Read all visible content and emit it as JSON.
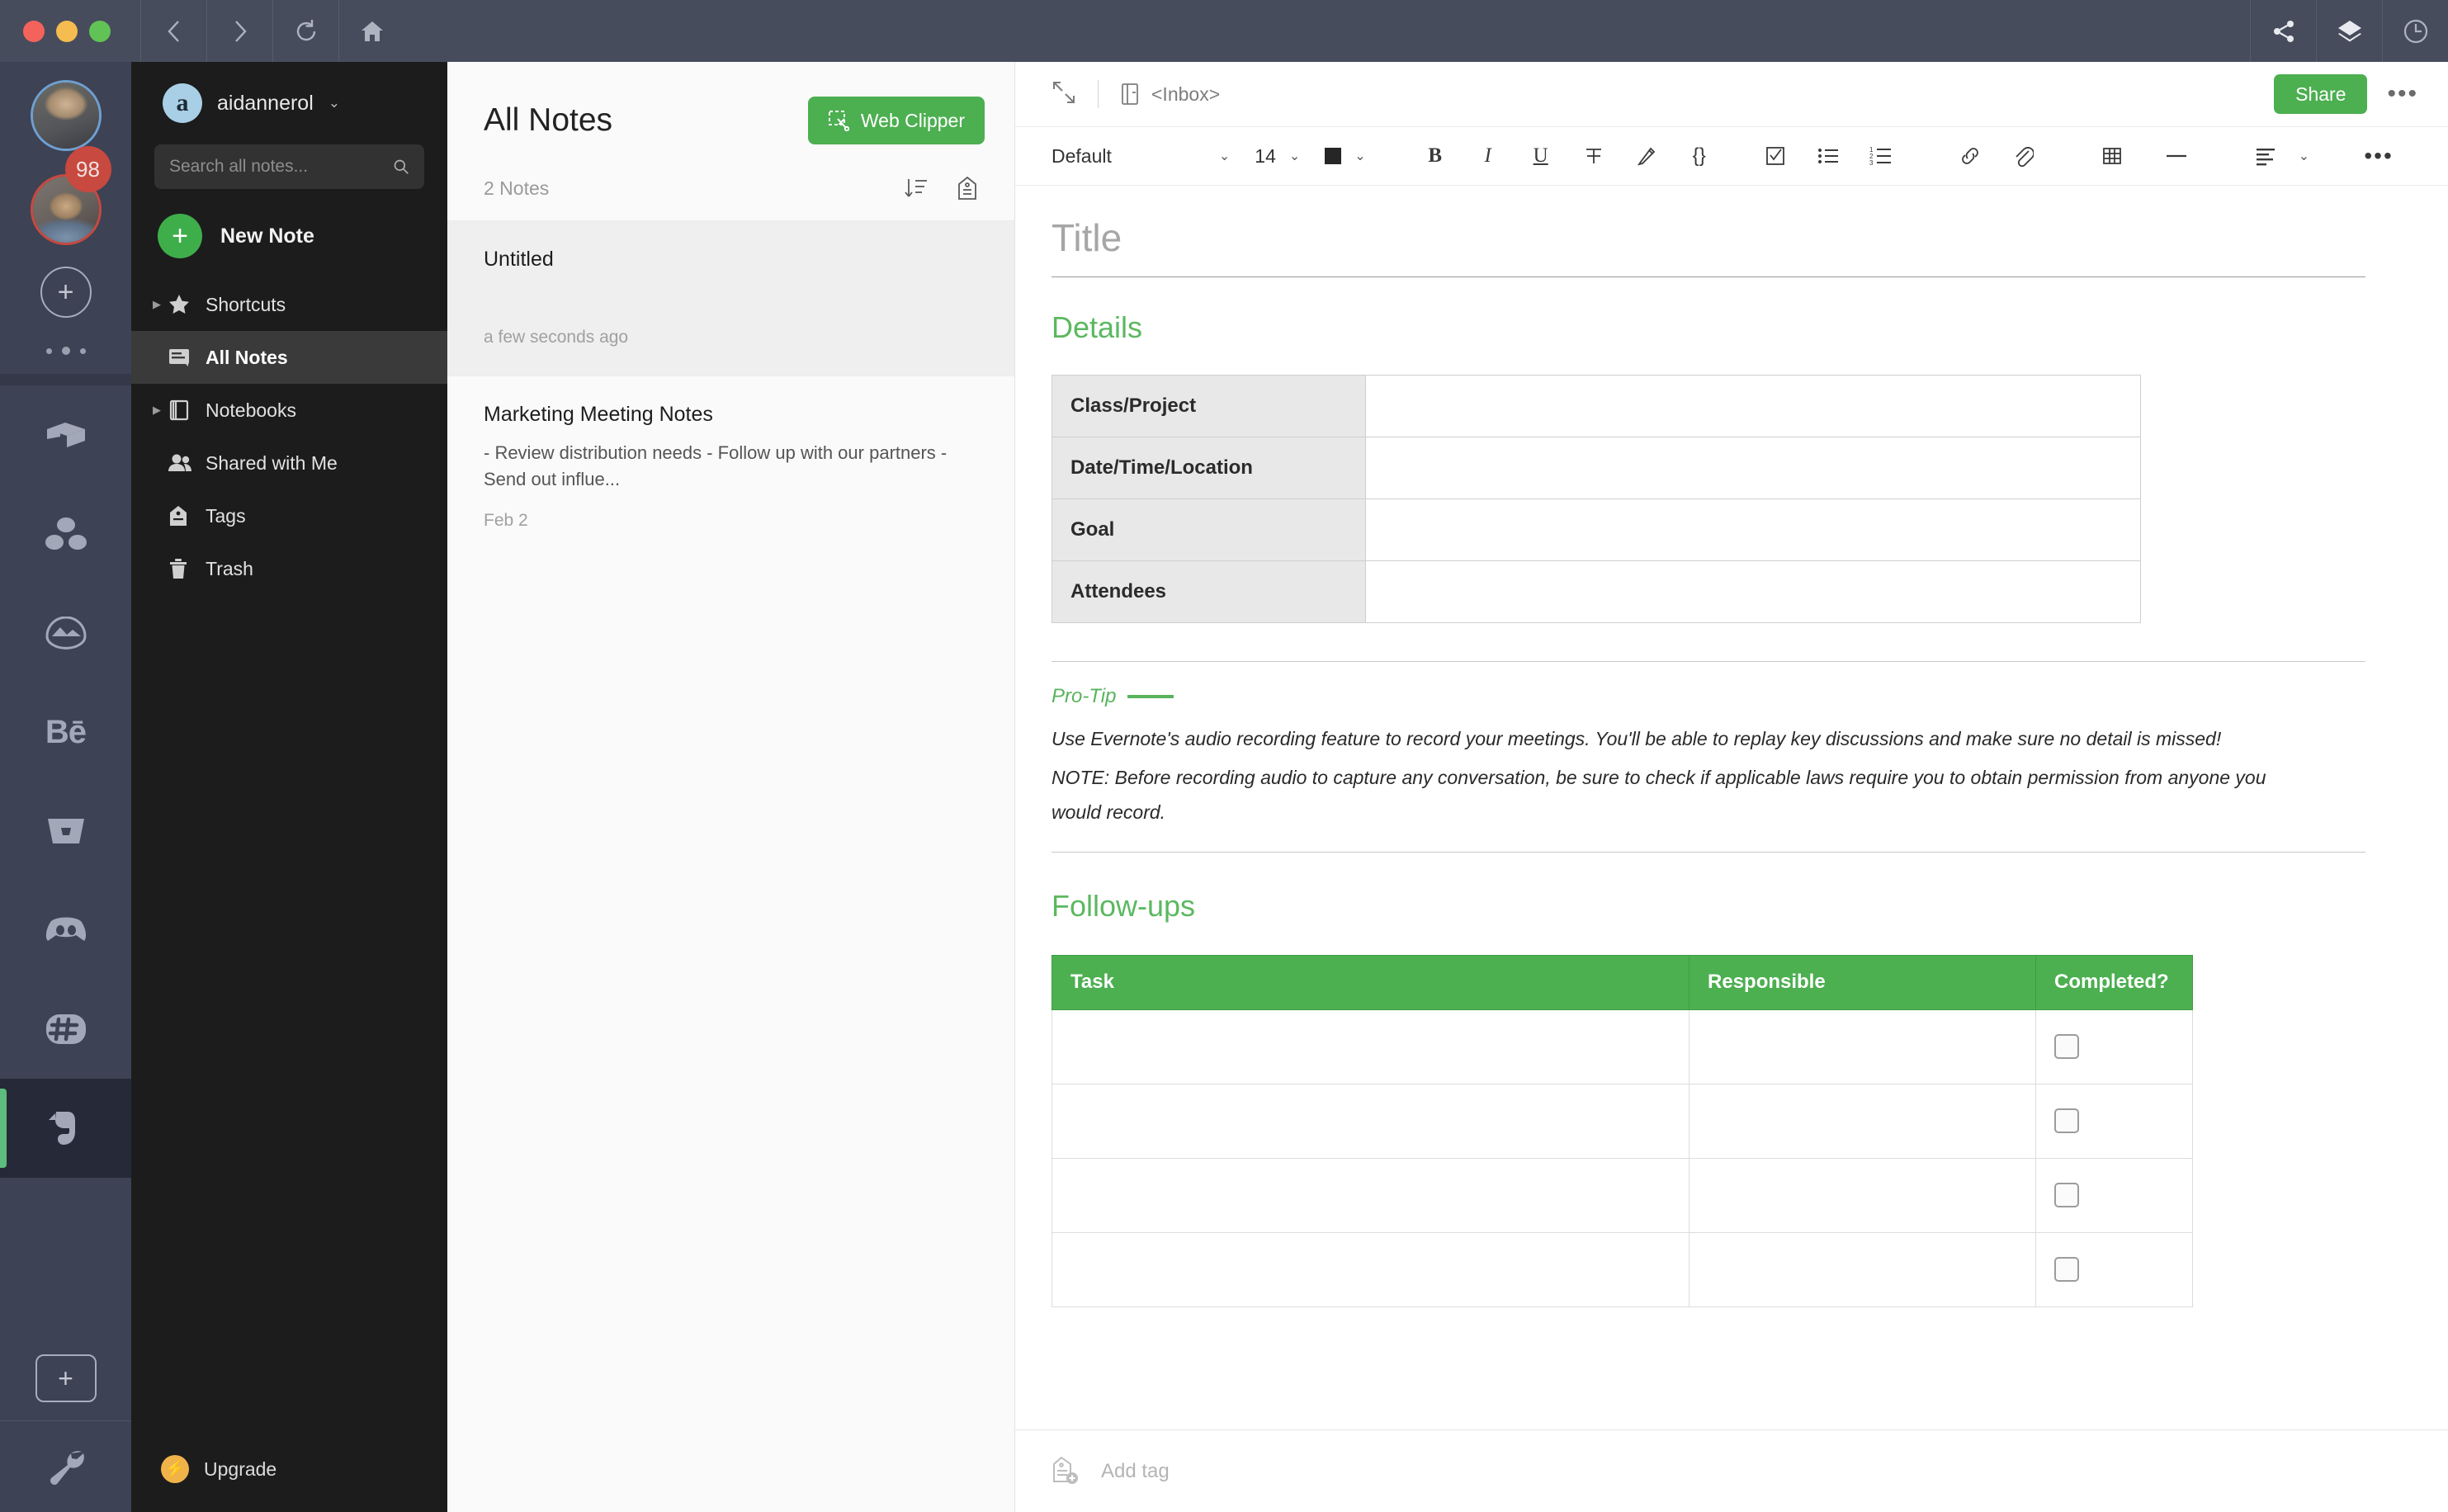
{
  "titlebar": {
    "traffic_lights": [
      "close",
      "minimize",
      "maximize"
    ],
    "nav": [
      {
        "name": "back",
        "icon": "chevron-left-icon"
      },
      {
        "name": "forward",
        "icon": "chevron-right-icon"
      },
      {
        "name": "reload",
        "icon": "reload-icon"
      },
      {
        "name": "home",
        "icon": "home-icon"
      }
    ],
    "right_actions": [
      {
        "name": "share",
        "icon": "share-icon"
      },
      {
        "name": "stack",
        "icon": "layers-icon"
      },
      {
        "name": "history",
        "icon": "clock-icon"
      }
    ],
    "accent": "#474c5c"
  },
  "rail": {
    "avatars": [
      {
        "name": "profile-avatar-1",
        "ring": "#6f9fd0",
        "badge": ""
      },
      {
        "name": "profile-avatar-2",
        "ring": "#c8493f",
        "badge": "98"
      }
    ],
    "add_profile_label": "+",
    "apps": [
      {
        "name": "dropbox",
        "icon": "box-icon"
      },
      {
        "name": "asana",
        "icon": "three-dots-circle-icon"
      },
      {
        "name": "icloud",
        "icon": "cloud-icon"
      },
      {
        "name": "behance",
        "icon": "behance-icon",
        "label": "Bē"
      },
      {
        "name": "basecamp",
        "icon": "basket-icon"
      },
      {
        "name": "discord",
        "icon": "discord-icon"
      },
      {
        "name": "slack",
        "icon": "slack-hash-icon"
      },
      {
        "name": "evernote",
        "icon": "evernote-elephant-icon",
        "active": true
      }
    ],
    "add_app_label": "+",
    "settings_icon": "wrench-icon",
    "active_indicator_color": "#5cbd7e"
  },
  "sidebar": {
    "account": {
      "name": "aidannerol",
      "avatar_letter": "a",
      "caret": "⌄"
    },
    "search": {
      "placeholder": "Search all notes...",
      "value": "",
      "icon": "search-icon"
    },
    "new_note": {
      "label": "New Note",
      "icon": "plus-icon"
    },
    "items": [
      {
        "label": "Shortcuts",
        "icon": "star-icon",
        "expandable": true,
        "selected": false
      },
      {
        "label": "All Notes",
        "icon": "notes-icon",
        "expandable": false,
        "selected": true
      },
      {
        "label": "Notebooks",
        "icon": "notebook-icon",
        "expandable": true,
        "selected": false
      },
      {
        "label": "Shared with Me",
        "icon": "people-icon",
        "expandable": false,
        "selected": false
      },
      {
        "label": "Tags",
        "icon": "tag-icon",
        "expandable": false,
        "selected": false
      },
      {
        "label": "Trash",
        "icon": "trash-icon",
        "expandable": false,
        "selected": false
      }
    ],
    "upgrade": {
      "label": "Upgrade",
      "icon": "bolt-icon",
      "color": "#f0b34a"
    }
  },
  "notes_list": {
    "title": "All Notes",
    "web_clipper": {
      "label": "Web Clipper",
      "icon": "clipper-icon",
      "color": "#4caf50"
    },
    "count_label": "2 Notes",
    "sort_icon": "sort-descending-icon",
    "tag_icon": "tag-filter-icon",
    "notes": [
      {
        "title": "Untitled",
        "snippet": "",
        "date": "a few seconds ago",
        "selected": true
      },
      {
        "title": "Marketing Meeting Notes",
        "snippet": "- Review distribution needs - Follow up with our partners - Send out influe...",
        "date": "Feb 2",
        "selected": false
      }
    ]
  },
  "editor": {
    "expand_icon": "expand-icon",
    "notebook": {
      "label": "<Inbox>",
      "icon": "notebook-small-icon"
    },
    "share_label": "Share",
    "more_label": "•••",
    "toolbar": {
      "font": "Default",
      "font_size": "14",
      "text_color": "#262626",
      "buttons": [
        {
          "name": "bold",
          "label": "B"
        },
        {
          "name": "italic",
          "label": "I"
        },
        {
          "name": "underline",
          "label": "U"
        },
        {
          "name": "strikethrough",
          "label": "T"
        },
        {
          "name": "highlight",
          "label": "highlight-icon"
        },
        {
          "name": "code-block",
          "label": "{}"
        },
        {
          "name": "checklist",
          "label": "checklist-icon"
        },
        {
          "name": "bulleted-list",
          "label": "bulleted-list-icon"
        },
        {
          "name": "numbered-list",
          "label": "numbered-list-icon"
        },
        {
          "name": "link",
          "label": "link-icon"
        },
        {
          "name": "attachment",
          "label": "paperclip-icon"
        },
        {
          "name": "table",
          "label": "table-icon"
        },
        {
          "name": "horizontal-rule",
          "label": "horizontal-rule-icon"
        },
        {
          "name": "alignment",
          "label": "align-left-icon"
        },
        {
          "name": "more-formatting",
          "label": "•••"
        }
      ]
    },
    "note": {
      "title_placeholder": "Title",
      "title_value": "",
      "details_heading": "Details",
      "details_rows": [
        {
          "label": "Class/Project",
          "value": ""
        },
        {
          "label": "Date/Time/Location",
          "value": ""
        },
        {
          "label": "Goal",
          "value": ""
        },
        {
          "label": "Attendees",
          "value": ""
        }
      ],
      "protip_label": "Pro-Tip",
      "protip_paragraphs": [
        "Use Evernote's audio recording feature to record your meetings. You'll be able to replay key discussions and make sure no detail is missed!",
        "NOTE: Before recording audio to capture any conversation, be sure to check if applicable laws require you to obtain permission from anyone you would record."
      ],
      "followups_heading": "Follow-ups",
      "followups_headers": [
        "Task",
        "Responsible",
        "Completed?"
      ],
      "followups_rows": [
        {
          "task": "",
          "responsible": "",
          "completed": false
        },
        {
          "task": "",
          "responsible": "",
          "completed": false
        },
        {
          "task": "",
          "responsible": "",
          "completed": false
        },
        {
          "task": "",
          "responsible": "",
          "completed": false
        }
      ]
    },
    "tag_bar": {
      "placeholder": "Add tag",
      "value": "",
      "icon": "add-tag-icon"
    }
  }
}
